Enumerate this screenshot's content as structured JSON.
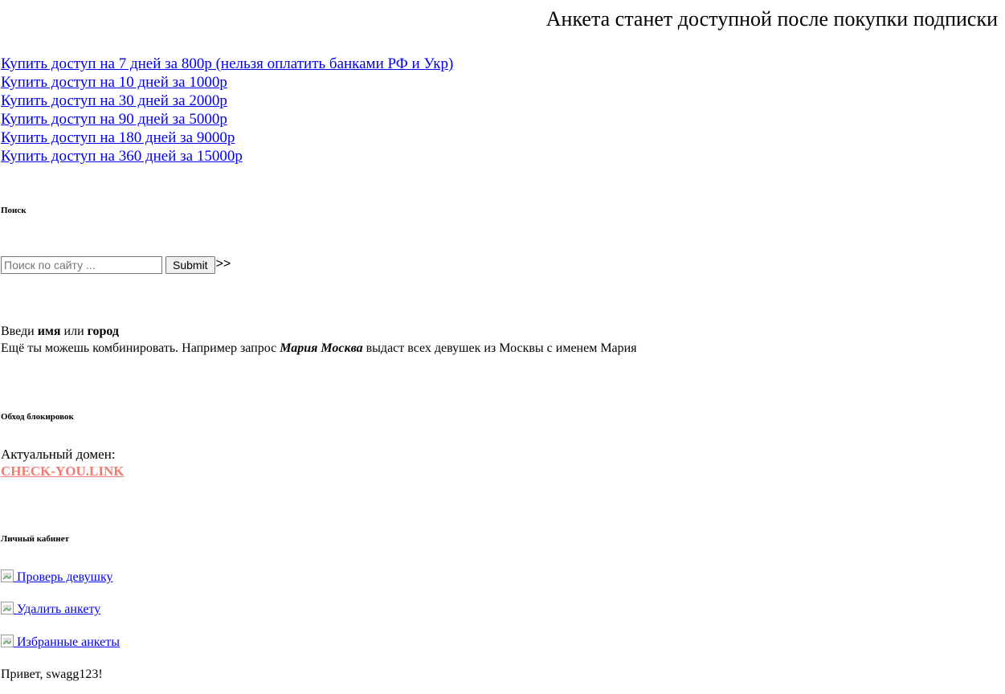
{
  "notice": "Анкета станет доступной после покупки подписки",
  "buy_links": [
    "Купить доступ на 7 дней за 800р (нельзя оплатить банками РФ и Укр)",
    "Купить доступ на 10 дней за 1000р",
    "Купить доступ на 30 дней за 2000р",
    "Купить доступ на 90 дней за 5000р",
    "Купить доступ на 180 дней за 9000р",
    "Купить доступ на 360 дней за 15000р"
  ],
  "search": {
    "heading": "Поиск",
    "placeholder": "Поиск по сайту ...",
    "value": "",
    "submit_label": "Submit",
    "arrows": ">>",
    "hint": {
      "line1_prefix": "Введи ",
      "name_word": "имя",
      "or_word": " или ",
      "city_word": "город",
      "line2_prefix": "Ещё ты можешь комбинировать. Например запрос ",
      "example_query": "Мария Москва",
      "line2_suffix": " выдаст всех девушек из Москвы с именем Мария"
    }
  },
  "bypass": {
    "heading": "Обход блокировок",
    "domain_label": "Актуальный домен:",
    "domain_link": "CHECK-YOU.LINK"
  },
  "cabinet": {
    "heading": "Личный кабинет",
    "links": [
      " Проверь девушку",
      " Удалить анкету",
      " Избранные анкеты"
    ],
    "greeting": "Привет, swagg123!"
  },
  "colors": {
    "link": "#0000ee",
    "domain_link": "#f07c72",
    "text": "#000000"
  }
}
